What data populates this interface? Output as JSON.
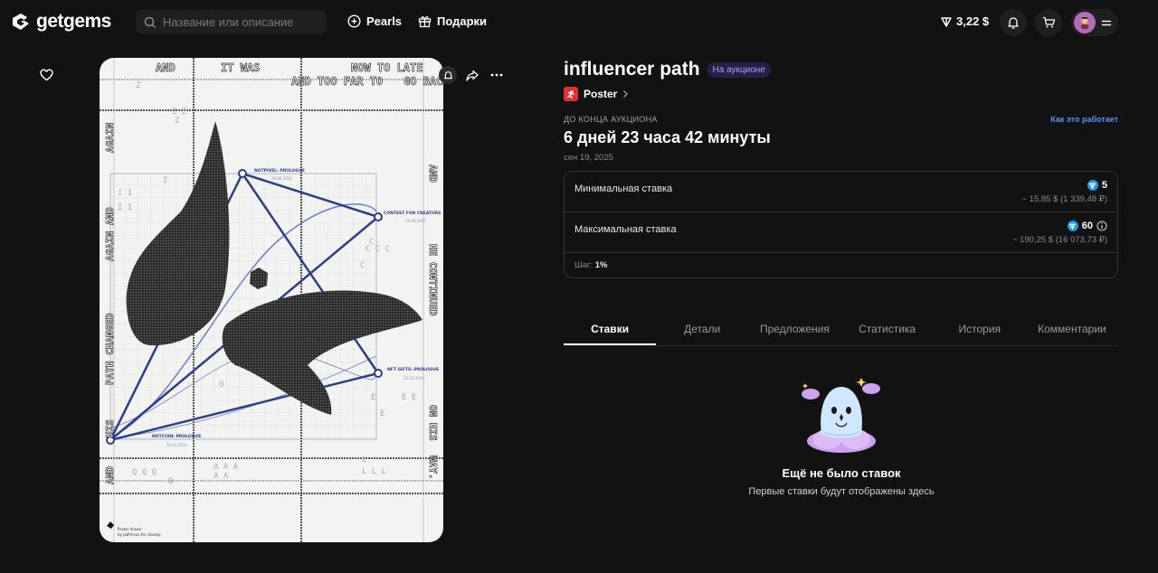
{
  "header": {
    "brand": "getgems",
    "search_placeholder": "Название или описание",
    "nav": [
      {
        "label": "Pearls",
        "icon": "plus-circle-icon"
      },
      {
        "label": "Подарки",
        "icon": "gift-icon"
      }
    ],
    "balance": "3,22 $"
  },
  "artwork": {
    "texts": {
      "and1": "AND",
      "itwas": "IT WAS",
      "nowtolate": "NOW TO LATE",
      "andtoofar": "AND TOO FAR TO",
      "goback": "GO BACK",
      "again": "AGAIN",
      "againand": "AGAIN AND",
      "pathchanged": "PATH CHANGED",
      "his": "HIS",
      "and2": "AND",
      "and3": "AND",
      "hecontinued": "HE CONTINUED",
      "onhis": "ON HIS",
      "way": "WAY.",
      "node1": "NOTPIXEL: PROLOGUE",
      "node1date": "29.08.2024",
      "node2": "CONTEST FOR CREATORS",
      "node2date": "24.08.2025",
      "node3": "NFT GIFTS: PROLOGUE",
      "node3date": "05.10.2024",
      "node4": "NOTCOIN: PROLOGUE",
      "node4date": "14.01.2024",
      "credit1": "Poster drawn",
      "credit2": "by paPerson for ctostop"
    }
  },
  "item": {
    "title": "influencer path",
    "status_badge": "На аукционе",
    "collection": "Poster",
    "timer_label": "ДО КОНЦА АУКЦИОНА",
    "how_it_works": "Как это работает",
    "time_left": "6 дней 23 часа 42 минуты",
    "end_date": "сен 19, 2025",
    "min_bid_label": "Минимальная ставка",
    "min_bid_value": "5",
    "min_bid_fiat": "~ 15,85 $ (1 339,48 ₽)",
    "max_bid_label": "Максимальная ставка",
    "max_bid_value": "60",
    "max_bid_fiat": "~ 190,25 $ (16 073,73 ₽)",
    "step_label": "Шаг:",
    "step_value": "1%"
  },
  "tabs": [
    "Ставки",
    "Детали",
    "Предложения",
    "Статистика",
    "История",
    "Комментарии"
  ],
  "active_tab": "Ставки",
  "empty_state": {
    "title": "Ещё не было ставок",
    "subtitle": "Первые ставки будут отображены здесь"
  },
  "colors": {
    "background": "#121212",
    "accent_blue": "#5b8cff",
    "ton_blue": "#1a9be6",
    "badge_purple": "#a99cff",
    "collection_red": "#e53033"
  }
}
